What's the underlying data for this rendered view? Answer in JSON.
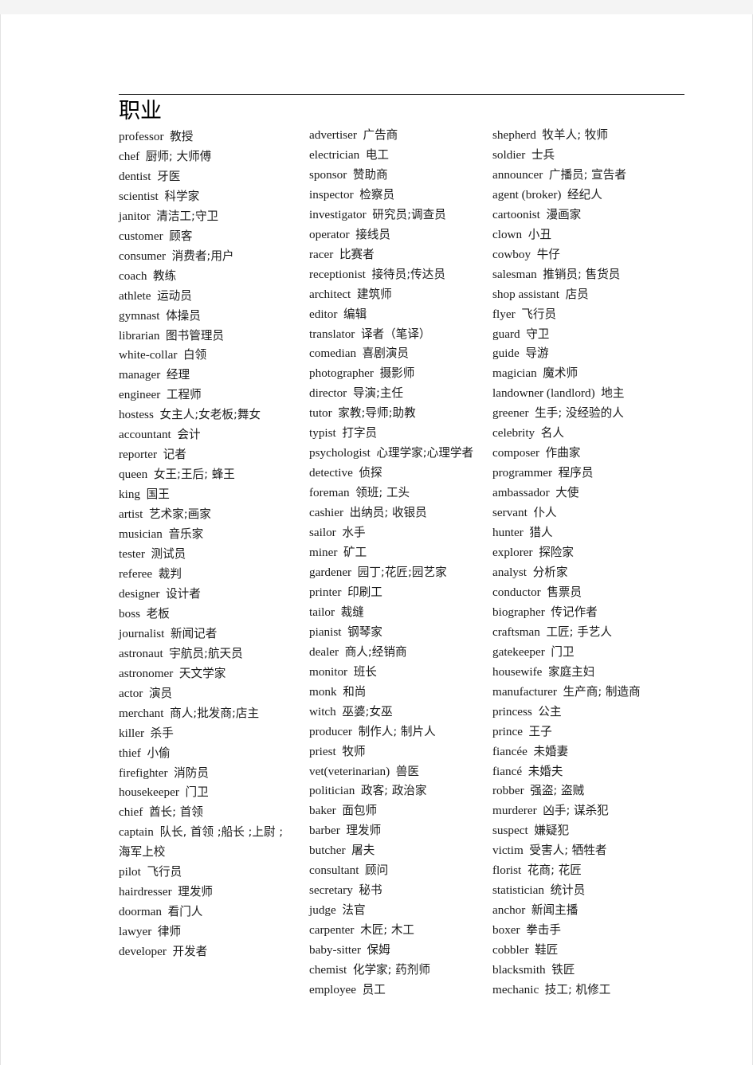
{
  "document": {
    "title": "职业",
    "columns": [
      {
        "name": "column-1",
        "entries": [
          {
            "en": "professor",
            "zh": "教授"
          },
          {
            "en": "chef",
            "zh": "厨师; 大师傅"
          },
          {
            "en": "dentist",
            "zh": "牙医"
          },
          {
            "en": "scientist",
            "zh": "科学家"
          },
          {
            "en": "janitor",
            "zh": "清洁工;守卫"
          },
          {
            "en": "customer",
            "zh": "顾客"
          },
          {
            "en": "consumer",
            "zh": "消费者;用户"
          },
          {
            "en": "coach",
            "zh": "教练"
          },
          {
            "en": "athlete",
            "zh": "运动员"
          },
          {
            "en": "gymnast",
            "zh": "体操员"
          },
          {
            "en": "librarian",
            "zh": "图书管理员"
          },
          {
            "en": "white-collar",
            "zh": "白领"
          },
          {
            "en": "manager",
            "zh": "经理"
          },
          {
            "en": "engineer",
            "zh": "工程师"
          },
          {
            "en": "hostess",
            "zh": "女主人;女老板;舞女"
          },
          {
            "en": "accountant",
            "zh": "会计"
          },
          {
            "en": "reporter",
            "zh": "记者"
          },
          {
            "en": "queen",
            "zh": "女王;王后; 蜂王"
          },
          {
            "en": "king",
            "zh": "国王"
          },
          {
            "en": "artist",
            "zh": "艺术家;画家"
          },
          {
            "en": "musician",
            "zh": "音乐家"
          },
          {
            "en": "tester",
            "zh": "测试员"
          },
          {
            "en": "referee",
            "zh": "裁判"
          },
          {
            "en": "designer",
            "zh": "设计者"
          },
          {
            "en": "boss",
            "zh": "老板"
          },
          {
            "en": "journalist",
            "zh": "新闻记者"
          },
          {
            "en": "astronaut",
            "zh": "宇航员;航天员"
          },
          {
            "en": "astronomer",
            "zh": "天文学家"
          },
          {
            "en": "actor",
            "zh": "演员"
          },
          {
            "en": "merchant",
            "zh": "商人;批发商;店主"
          },
          {
            "en": "killer",
            "zh": "杀手"
          },
          {
            "en": "thief",
            "zh": "小偷"
          },
          {
            "en": "firefighter",
            "zh": "消防员"
          },
          {
            "en": "housekeeper",
            "zh": "门卫"
          },
          {
            "en": "chief",
            "zh": "酋长; 首领"
          },
          {
            "en": "captain",
            "zh": "队长, 首领 ;船长 ;上尉 ;"
          },
          {
            "en": "",
            "zh": "海军上校"
          },
          {
            "en": "pilot",
            "zh": "飞行员"
          },
          {
            "en": "hairdresser",
            "zh": "理发师"
          },
          {
            "en": "doorman",
            "zh": "看门人"
          },
          {
            "en": "lawyer",
            "zh": "律师"
          },
          {
            "en": "developer",
            "zh": "开发者"
          }
        ]
      },
      {
        "name": "column-2",
        "entries": [
          {
            "en": "advertiser",
            "zh": "广告商"
          },
          {
            "en": "electrician",
            "zh": "电工"
          },
          {
            "en": "sponsor",
            "zh": "赞助商"
          },
          {
            "en": "inspector",
            "zh": "检察员"
          },
          {
            "en": "investigator",
            "zh": "研究员;调查员"
          },
          {
            "en": "operator",
            "zh": "接线员"
          },
          {
            "en": "racer",
            "zh": "比赛者"
          },
          {
            "en": "receptionist",
            "zh": "接待员;传达员"
          },
          {
            "en": "architect",
            "zh": "建筑师"
          },
          {
            "en": "editor",
            "zh": "编辑"
          },
          {
            "en": "translator",
            "zh": "译者（笔译）"
          },
          {
            "en": "comedian",
            "zh": "喜剧演员"
          },
          {
            "en": "photographer",
            "zh": "摄影师"
          },
          {
            "en": "director",
            "zh": "导演;主任"
          },
          {
            "en": "tutor",
            "zh": "家教;导师;助教"
          },
          {
            "en": "typist",
            "zh": "打字员"
          },
          {
            "en": "psychologist",
            "zh": "心理学家;心理学者"
          },
          {
            "en": "detective",
            "zh": "侦探"
          },
          {
            "en": "foreman",
            "zh": "领班; 工头"
          },
          {
            "en": "cashier",
            "zh": "出纳员; 收银员"
          },
          {
            "en": "sailor",
            "zh": "水手"
          },
          {
            "en": "miner",
            "zh": "矿工"
          },
          {
            "en": "gardener",
            "zh": "园丁;花匠;园艺家"
          },
          {
            "en": "printer",
            "zh": "印刷工"
          },
          {
            "en": "tailor",
            "zh": "裁缝"
          },
          {
            "en": "pianist",
            "zh": "钢琴家"
          },
          {
            "en": "dealer",
            "zh": "商人;经销商"
          },
          {
            "en": "monitor",
            "zh": "班长"
          },
          {
            "en": "monk",
            "zh": "和尚"
          },
          {
            "en": "witch",
            "zh": "巫婆;女巫"
          },
          {
            "en": "producer",
            "zh": "制作人; 制片人"
          },
          {
            "en": "priest",
            "zh": "牧师"
          },
          {
            "en": "vet(veterinarian)",
            "zh": "兽医"
          },
          {
            "en": "politician",
            "zh": "政客; 政治家"
          },
          {
            "en": "baker",
            "zh": "面包师"
          },
          {
            "en": "barber",
            "zh": "理发师"
          },
          {
            "en": "butcher",
            "zh": "屠夫"
          },
          {
            "en": "consultant",
            "zh": "顾问"
          },
          {
            "en": "secretary",
            "zh": "秘书"
          },
          {
            "en": "judge",
            "zh": "法官"
          },
          {
            "en": "carpenter",
            "zh": "木匠; 木工"
          },
          {
            "en": "baby-sitter",
            "zh": "保姆"
          },
          {
            "en": "chemist",
            "zh": "化学家; 药剂师"
          },
          {
            "en": "employee",
            "zh": "员工"
          }
        ]
      },
      {
        "name": "column-3",
        "entries": [
          {
            "en": "shepherd",
            "zh": "牧羊人; 牧师"
          },
          {
            "en": "soldier",
            "zh": "士兵"
          },
          {
            "en": "announcer",
            "zh": "广播员; 宣告者"
          },
          {
            "en": "agent (broker)",
            "zh": "经纪人"
          },
          {
            "en": "cartoonist",
            "zh": "漫画家"
          },
          {
            "en": "clown",
            "zh": "小丑"
          },
          {
            "en": "cowboy",
            "zh": "牛仔"
          },
          {
            "en": "salesman",
            "zh": "推销员; 售货员"
          },
          {
            "en": "shop assistant",
            "zh": "店员"
          },
          {
            "en": "flyer",
            "zh": "飞行员"
          },
          {
            "en": "guard",
            "zh": "守卫"
          },
          {
            "en": "guide",
            "zh": "导游"
          },
          {
            "en": "magician",
            "zh": "魔术师"
          },
          {
            "en": "landowner (landlord)",
            "zh": "地主"
          },
          {
            "en": "greener",
            "zh": "生手; 没经验的人"
          },
          {
            "en": "celebrity",
            "zh": "名人"
          },
          {
            "en": "composer",
            "zh": "作曲家"
          },
          {
            "en": "programmer",
            "zh": "程序员"
          },
          {
            "en": "ambassador",
            "zh": "大使"
          },
          {
            "en": "servant",
            "zh": "仆人"
          },
          {
            "en": "hunter",
            "zh": "猎人"
          },
          {
            "en": "explorer",
            "zh": "探险家"
          },
          {
            "en": "analyst",
            "zh": "分析家"
          },
          {
            "en": "conductor",
            "zh": "售票员"
          },
          {
            "en": "biographer",
            "zh": "传记作者"
          },
          {
            "en": "craftsman",
            "zh": "工匠; 手艺人"
          },
          {
            "en": "gatekeeper",
            "zh": "门卫"
          },
          {
            "en": "housewife",
            "zh": "家庭主妇"
          },
          {
            "en": "manufacturer",
            "zh": "生产商; 制造商"
          },
          {
            "en": "princess",
            "zh": "公主"
          },
          {
            "en": "prince",
            "zh": "王子"
          },
          {
            "en": "fiancée",
            "zh": "未婚妻"
          },
          {
            "en": "fiancé",
            "zh": "未婚夫"
          },
          {
            "en": "robber",
            "zh": "强盗; 盗贼"
          },
          {
            "en": "murderer",
            "zh": "凶手; 谋杀犯"
          },
          {
            "en": "suspect",
            "zh": "嫌疑犯"
          },
          {
            "en": "victim",
            "zh": "受害人; 牺牲者"
          },
          {
            "en": "florist",
            "zh": "花商; 花匠"
          },
          {
            "en": "statistician",
            "zh": "统计员"
          },
          {
            "en": "anchor",
            "zh": "新闻主播"
          },
          {
            "en": "boxer",
            "zh": "拳击手"
          },
          {
            "en": "cobbler",
            "zh": "鞋匠"
          },
          {
            "en": "blacksmith",
            "zh": "铁匠"
          },
          {
            "en": "mechanic",
            "zh": "技工; 机修工"
          }
        ]
      }
    ]
  }
}
